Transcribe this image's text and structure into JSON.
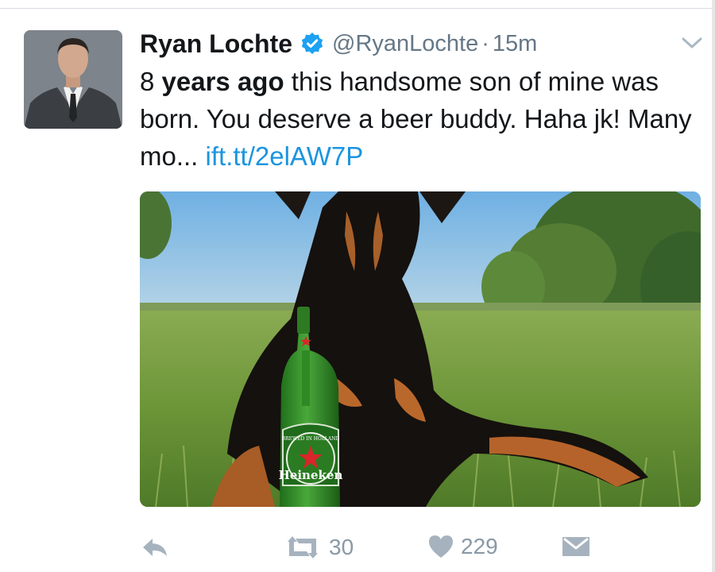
{
  "tweet": {
    "author_name": "Ryan Lochte",
    "handle": "@RyanLochte",
    "separator": "·",
    "time": "15m",
    "text_prefix": "8 ",
    "text_bold": "years ago",
    "text_rest": " this handsome son of mine was born. You deserve a beer buddy. Haha jk! Many mo... ",
    "link": "ift.tt/2elAW7P"
  },
  "media": {
    "bottle_brand": "Heineken",
    "bottle_label_top": "BREWED IN HOLLAND"
  },
  "actions": {
    "retweet_count": "30",
    "like_count": "229"
  },
  "colors": {
    "link": "#1b95e0",
    "verified": "#1da1f2",
    "muted": "#657786",
    "action": "#8899a6"
  },
  "icons": {
    "verified": "verified-badge-icon",
    "caret": "chevron-down-icon",
    "reply": "reply-icon",
    "retweet": "retweet-icon",
    "like": "heart-icon",
    "dm": "envelope-icon"
  }
}
